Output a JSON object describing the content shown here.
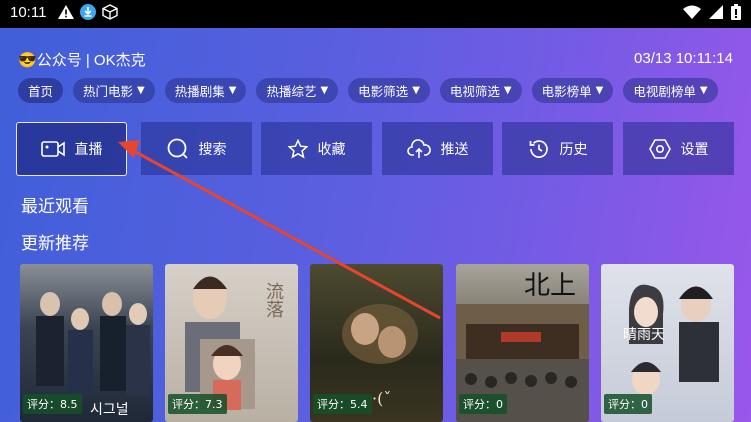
{
  "status_bar": {
    "time": "10:11"
  },
  "header": {
    "title": "公众号 | OK杰克",
    "datetime": "03/13 10:11:14"
  },
  "tabs": [
    {
      "label": "首页",
      "filter": false
    },
    {
      "label": "热门电影",
      "filter": true
    },
    {
      "label": "热播剧集",
      "filter": true
    },
    {
      "label": "热播综艺",
      "filter": true
    },
    {
      "label": "电影筛选",
      "filter": true
    },
    {
      "label": "电视筛选",
      "filter": true
    },
    {
      "label": "电影榜单",
      "filter": true
    },
    {
      "label": "电视剧榜单",
      "filter": true
    }
  ],
  "actions": [
    {
      "label": "直播",
      "icon": "video-camera-icon"
    },
    {
      "label": "搜索",
      "icon": "search-icon"
    },
    {
      "label": "收藏",
      "icon": "star-icon"
    },
    {
      "label": "推送",
      "icon": "cloud-upload-icon"
    },
    {
      "label": "历史",
      "icon": "history-icon"
    },
    {
      "label": "设置",
      "icon": "settings-hexagon-icon"
    }
  ],
  "sections": {
    "recent": "最近观看",
    "recommend": "更新推荐"
  },
  "cards": [
    {
      "score": "评分：8.5",
      "color": "#2b3545"
    },
    {
      "score": "评分：7.3",
      "color": "#c7c0b6",
      "title": "流落"
    },
    {
      "score": "评分：5.4",
      "color": "#3a3a28"
    },
    {
      "score": "评分：0",
      "color": "#5a5346"
    },
    {
      "score": "评分：0",
      "color": "#c9cdd8",
      "title": "晴雨天"
    }
  ],
  "accent": {
    "arrow": "#e6452f",
    "highlight_border": "#e8e8ff"
  }
}
